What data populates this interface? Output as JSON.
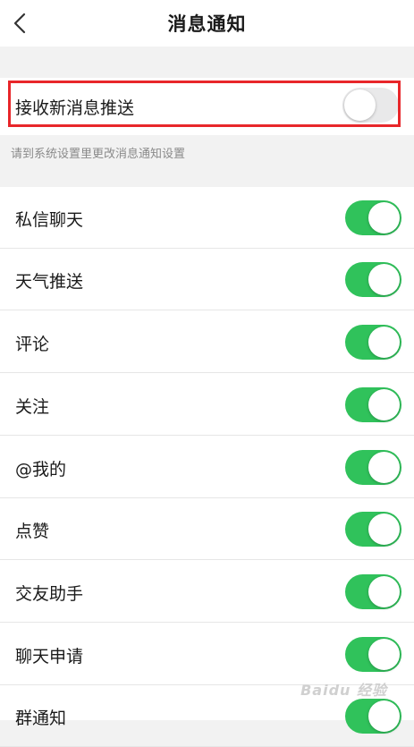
{
  "header": {
    "title": "消息通知"
  },
  "master": {
    "label": "接收新消息推送",
    "enabled": false
  },
  "hint": "请到系统设置里更改消息通知设置",
  "settings": [
    {
      "label": "私信聊天",
      "enabled": true
    },
    {
      "label": "天气推送",
      "enabled": true
    },
    {
      "label": "评论",
      "enabled": true
    },
    {
      "label": "关注",
      "enabled": true
    },
    {
      "label": "@我的",
      "enabled": true
    },
    {
      "label": "点赞",
      "enabled": true
    },
    {
      "label": "交友助手",
      "enabled": true
    },
    {
      "label": "聊天申请",
      "enabled": true
    },
    {
      "label": "群通知",
      "enabled": true
    }
  ],
  "watermark": "Baidu 经验",
  "colors": {
    "toggle_on": "#30c25b",
    "toggle_off": "#e9e9ea",
    "highlight": "#e8262a"
  }
}
